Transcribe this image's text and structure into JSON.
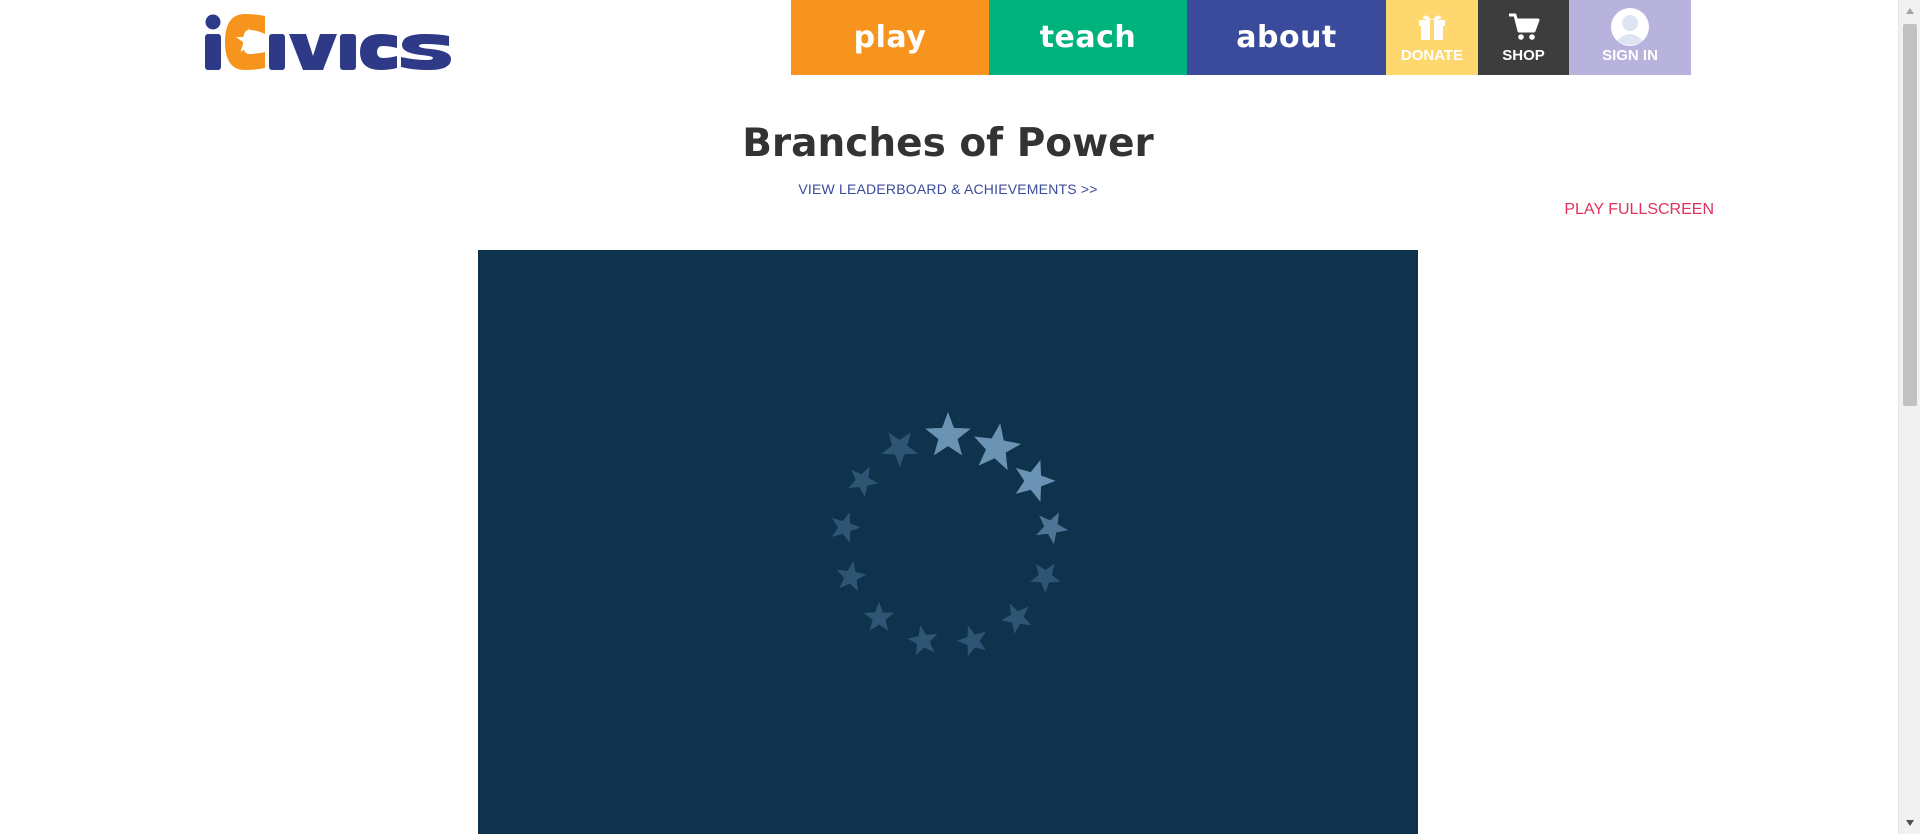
{
  "header": {
    "logo_text": "iCivics",
    "nav": {
      "play": "play",
      "teach": "teach",
      "about": "about",
      "donate": "DONATE",
      "shop": "SHOP",
      "sign_in": "SIGN IN"
    },
    "icons": {
      "donate": "gift-icon",
      "shop": "cart-icon",
      "sign_in": "user-avatar-icon"
    }
  },
  "page": {
    "title": "Branches of Power",
    "leaderboard_link": "VIEW LEADERBOARD & ACHIEVEMENTS >>",
    "fullscreen_link": "PLAY FULLSCREEN"
  },
  "game": {
    "state": "loading",
    "loader_icon": "star-ring-spinner-icon"
  },
  "colors": {
    "play": "#f7941d",
    "teach": "#00b27c",
    "about": "#3b4b9b",
    "donate": "#fed86e",
    "shop": "#3d3d3d",
    "sign_in": "#b7b3dc",
    "title": "#333333",
    "link": "#3b4b9b",
    "fullscreen": "#e1315b",
    "game_bg": "#0f334c"
  }
}
